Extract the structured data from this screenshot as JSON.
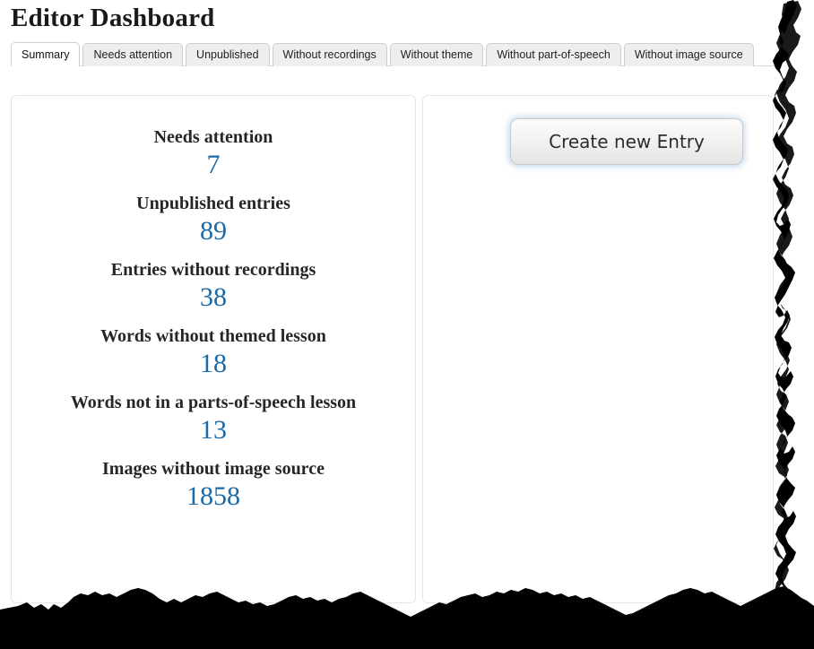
{
  "header": {
    "title": "Editor Dashboard"
  },
  "tabs": [
    {
      "label": "Summary",
      "active": true
    },
    {
      "label": "Needs attention",
      "active": false
    },
    {
      "label": "Unpublished",
      "active": false
    },
    {
      "label": "Without recordings",
      "active": false
    },
    {
      "label": "Without theme",
      "active": false
    },
    {
      "label": "Without part-of-speech",
      "active": false
    },
    {
      "label": "Without image source",
      "active": false
    }
  ],
  "summary": {
    "stats": [
      {
        "label": "Needs attention",
        "value": "7"
      },
      {
        "label": "Unpublished entries",
        "value": "89"
      },
      {
        "label": "Entries without recordings",
        "value": "38"
      },
      {
        "label": "Words without themed lesson",
        "value": "18"
      },
      {
        "label": "Words not in a parts-of-speech lesson",
        "value": "13"
      },
      {
        "label": "Images without image source",
        "value": "1858"
      }
    ]
  },
  "actions": {
    "create_entry_label": "Create new Entry"
  },
  "colors": {
    "stat_value": "#1a6aa8",
    "stat_label": "#262626",
    "panel_border": "#e6e6e6",
    "tab_inactive_bg": "#eeeeee",
    "tab_border": "#cfcfcf",
    "button_glow": "#96bee1"
  },
  "decoration": {
    "torn_edge_right": "ragged-black-torn-paper-edge",
    "torn_edge_bottom": "ragged-black-torn-paper-edge"
  }
}
